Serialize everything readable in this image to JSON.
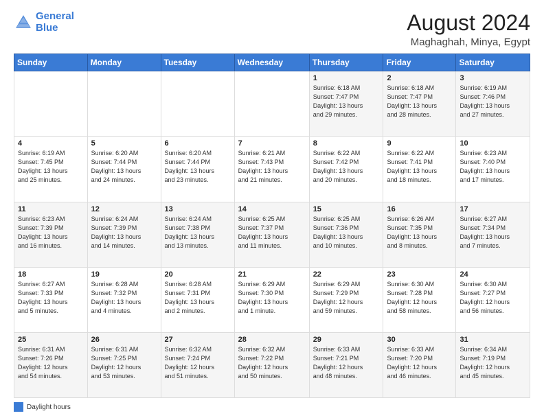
{
  "header": {
    "logo_line1": "General",
    "logo_line2": "Blue",
    "month": "August 2024",
    "location": "Maghaghah, Minya, Egypt"
  },
  "weekdays": [
    "Sunday",
    "Monday",
    "Tuesday",
    "Wednesday",
    "Thursday",
    "Friday",
    "Saturday"
  ],
  "footer": {
    "daylight_label": "Daylight hours"
  },
  "weeks": [
    [
      {
        "day": "",
        "info": ""
      },
      {
        "day": "",
        "info": ""
      },
      {
        "day": "",
        "info": ""
      },
      {
        "day": "",
        "info": ""
      },
      {
        "day": "1",
        "info": "Sunrise: 6:18 AM\nSunset: 7:47 PM\nDaylight: 13 hours\nand 29 minutes."
      },
      {
        "day": "2",
        "info": "Sunrise: 6:18 AM\nSunset: 7:47 PM\nDaylight: 13 hours\nand 28 minutes."
      },
      {
        "day": "3",
        "info": "Sunrise: 6:19 AM\nSunset: 7:46 PM\nDaylight: 13 hours\nand 27 minutes."
      }
    ],
    [
      {
        "day": "4",
        "info": "Sunrise: 6:19 AM\nSunset: 7:45 PM\nDaylight: 13 hours\nand 25 minutes."
      },
      {
        "day": "5",
        "info": "Sunrise: 6:20 AM\nSunset: 7:44 PM\nDaylight: 13 hours\nand 24 minutes."
      },
      {
        "day": "6",
        "info": "Sunrise: 6:20 AM\nSunset: 7:44 PM\nDaylight: 13 hours\nand 23 minutes."
      },
      {
        "day": "7",
        "info": "Sunrise: 6:21 AM\nSunset: 7:43 PM\nDaylight: 13 hours\nand 21 minutes."
      },
      {
        "day": "8",
        "info": "Sunrise: 6:22 AM\nSunset: 7:42 PM\nDaylight: 13 hours\nand 20 minutes."
      },
      {
        "day": "9",
        "info": "Sunrise: 6:22 AM\nSunset: 7:41 PM\nDaylight: 13 hours\nand 18 minutes."
      },
      {
        "day": "10",
        "info": "Sunrise: 6:23 AM\nSunset: 7:40 PM\nDaylight: 13 hours\nand 17 minutes."
      }
    ],
    [
      {
        "day": "11",
        "info": "Sunrise: 6:23 AM\nSunset: 7:39 PM\nDaylight: 13 hours\nand 16 minutes."
      },
      {
        "day": "12",
        "info": "Sunrise: 6:24 AM\nSunset: 7:39 PM\nDaylight: 13 hours\nand 14 minutes."
      },
      {
        "day": "13",
        "info": "Sunrise: 6:24 AM\nSunset: 7:38 PM\nDaylight: 13 hours\nand 13 minutes."
      },
      {
        "day": "14",
        "info": "Sunrise: 6:25 AM\nSunset: 7:37 PM\nDaylight: 13 hours\nand 11 minutes."
      },
      {
        "day": "15",
        "info": "Sunrise: 6:25 AM\nSunset: 7:36 PM\nDaylight: 13 hours\nand 10 minutes."
      },
      {
        "day": "16",
        "info": "Sunrise: 6:26 AM\nSunset: 7:35 PM\nDaylight: 13 hours\nand 8 minutes."
      },
      {
        "day": "17",
        "info": "Sunrise: 6:27 AM\nSunset: 7:34 PM\nDaylight: 13 hours\nand 7 minutes."
      }
    ],
    [
      {
        "day": "18",
        "info": "Sunrise: 6:27 AM\nSunset: 7:33 PM\nDaylight: 13 hours\nand 5 minutes."
      },
      {
        "day": "19",
        "info": "Sunrise: 6:28 AM\nSunset: 7:32 PM\nDaylight: 13 hours\nand 4 minutes."
      },
      {
        "day": "20",
        "info": "Sunrise: 6:28 AM\nSunset: 7:31 PM\nDaylight: 13 hours\nand 2 minutes."
      },
      {
        "day": "21",
        "info": "Sunrise: 6:29 AM\nSunset: 7:30 PM\nDaylight: 13 hours\nand 1 minute."
      },
      {
        "day": "22",
        "info": "Sunrise: 6:29 AM\nSunset: 7:29 PM\nDaylight: 12 hours\nand 59 minutes."
      },
      {
        "day": "23",
        "info": "Sunrise: 6:30 AM\nSunset: 7:28 PM\nDaylight: 12 hours\nand 58 minutes."
      },
      {
        "day": "24",
        "info": "Sunrise: 6:30 AM\nSunset: 7:27 PM\nDaylight: 12 hours\nand 56 minutes."
      }
    ],
    [
      {
        "day": "25",
        "info": "Sunrise: 6:31 AM\nSunset: 7:26 PM\nDaylight: 12 hours\nand 54 minutes."
      },
      {
        "day": "26",
        "info": "Sunrise: 6:31 AM\nSunset: 7:25 PM\nDaylight: 12 hours\nand 53 minutes."
      },
      {
        "day": "27",
        "info": "Sunrise: 6:32 AM\nSunset: 7:24 PM\nDaylight: 12 hours\nand 51 minutes."
      },
      {
        "day": "28",
        "info": "Sunrise: 6:32 AM\nSunset: 7:22 PM\nDaylight: 12 hours\nand 50 minutes."
      },
      {
        "day": "29",
        "info": "Sunrise: 6:33 AM\nSunset: 7:21 PM\nDaylight: 12 hours\nand 48 minutes."
      },
      {
        "day": "30",
        "info": "Sunrise: 6:33 AM\nSunset: 7:20 PM\nDaylight: 12 hours\nand 46 minutes."
      },
      {
        "day": "31",
        "info": "Sunrise: 6:34 AM\nSunset: 7:19 PM\nDaylight: 12 hours\nand 45 minutes."
      }
    ]
  ]
}
